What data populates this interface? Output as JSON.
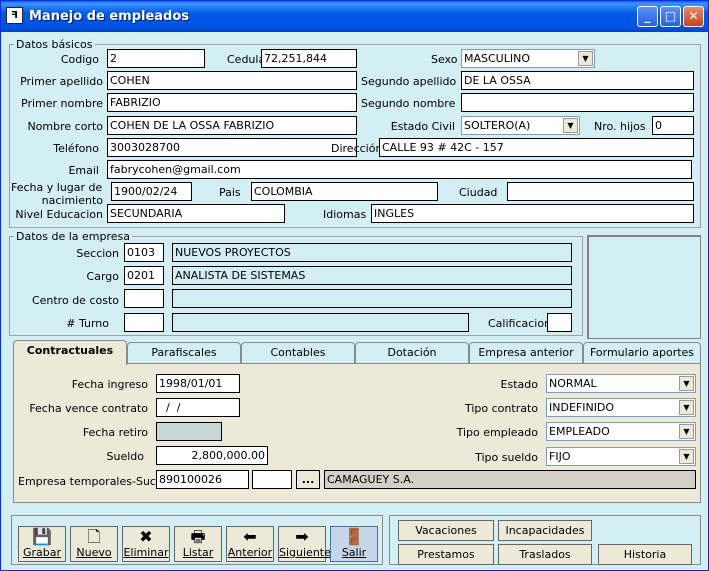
{
  "window": {
    "title": "Manejo de empleados",
    "icon": "app-icon",
    "minimize": "_",
    "maximize": "□",
    "close": "✕"
  },
  "basicos": {
    "legend": "Datos básicos",
    "codigo_label": "Codigo",
    "codigo": "2",
    "cedula_label": "Cedula",
    "cedula": "72,251,844",
    "sexo_label": "Sexo",
    "sexo": "MASCULINO",
    "primer_apellido_label": "Primer apellido",
    "primer_apellido": "COHEN",
    "segundo_apellido_label": "Segundo apellido",
    "segundo_apellido": "DE LA OSSA",
    "primer_nombre_label": "Primer nombre",
    "primer_nombre": "FABRIZIO",
    "segundo_nombre_label": "Segundo nombre",
    "segundo_nombre": "",
    "nombre_corto_label": "Nombre corto",
    "nombre_corto": "COHEN DE LA OSSA FABRIZIO",
    "estado_civil_label": "Estado Civil",
    "estado_civil": "SOLTERO(A)",
    "nro_hijos_label": "Nro. hijos",
    "nro_hijos": "0",
    "telefono_label": "Teléfono",
    "telefono": "3003028700",
    "direccion_label": "Dirección",
    "direccion": "CALLE 93 # 42C - 157",
    "email_label": "Email",
    "email": "fabrycohen@gmail.com",
    "fecha_lugar_label_1": "Fecha y lugar de",
    "fecha_lugar_label_2": "nacimiento",
    "fecha_nacimiento": "1900/02/24",
    "pais_label": "Pais",
    "pais": "COLOMBIA",
    "ciudad_label": "Ciudad",
    "ciudad": "",
    "nivel_label": "Nivel Educacion",
    "nivel": "SECUNDARIA",
    "idiomas_label": "Idiomas",
    "idiomas": "INGLES"
  },
  "empresa": {
    "legend": "Datos de la empresa",
    "seccion_label": "Seccion",
    "seccion_code": "0103",
    "seccion_name": "NUEVOS PROYECTOS",
    "cargo_label": "Cargo",
    "cargo_code": "0201",
    "cargo_name": "ANALISTA DE SISTEMAS",
    "centro_label": "Centro de costo",
    "centro_code": "",
    "centro_name": "",
    "turno_label": "# Turno",
    "turno_code": "",
    "turno_name": "",
    "calificacion_label": "Calificacion",
    "calificacion": ""
  },
  "tabs": [
    "Contractuales",
    "Parafiscales",
    "Contables",
    "Dotación",
    "Empresa anterior",
    "Formulario aportes"
  ],
  "contractuales": {
    "fecha_ingreso_label": "Fecha ingreso",
    "fecha_ingreso": "1998/01/01",
    "fecha_vence_label": "Fecha vence contrato",
    "fecha_vence": "  /  /",
    "fecha_retiro_label": "Fecha retiro",
    "fecha_retiro": "",
    "sueldo_label": "Sueldo",
    "sueldo": "2,800,000.00",
    "emp_temp_label": "Empresa temporales-Suc",
    "emp_temp_nit": "890100026",
    "emp_temp_suc": "",
    "emp_temp_btn": "...",
    "emp_temp_name": "CAMAGUEY S.A.",
    "estado_label": "Estado",
    "estado": "NORMAL",
    "tipo_contrato_label": "Tipo contrato",
    "tipo_contrato": "INDEFINIDO",
    "tipo_empleado_label": "Tipo empleado",
    "tipo_empleado": "EMPLEADO",
    "tipo_sueldo_label": "Tipo sueldo",
    "tipo_sueldo": "FIJO"
  },
  "toolbar": {
    "grabar": "Grabar",
    "nuevo": "Nuevo",
    "eliminar": "Eliminar",
    "listar": "Listar",
    "anterior": "Anterior",
    "siguiente": "Siguiente",
    "salir": "Salir"
  },
  "actions": {
    "vacaciones": "Vacaciones",
    "incapacidades": "Incapacidades",
    "prestamos": "Prestamos",
    "traslados": "Traslados",
    "historia": "Historia"
  }
}
